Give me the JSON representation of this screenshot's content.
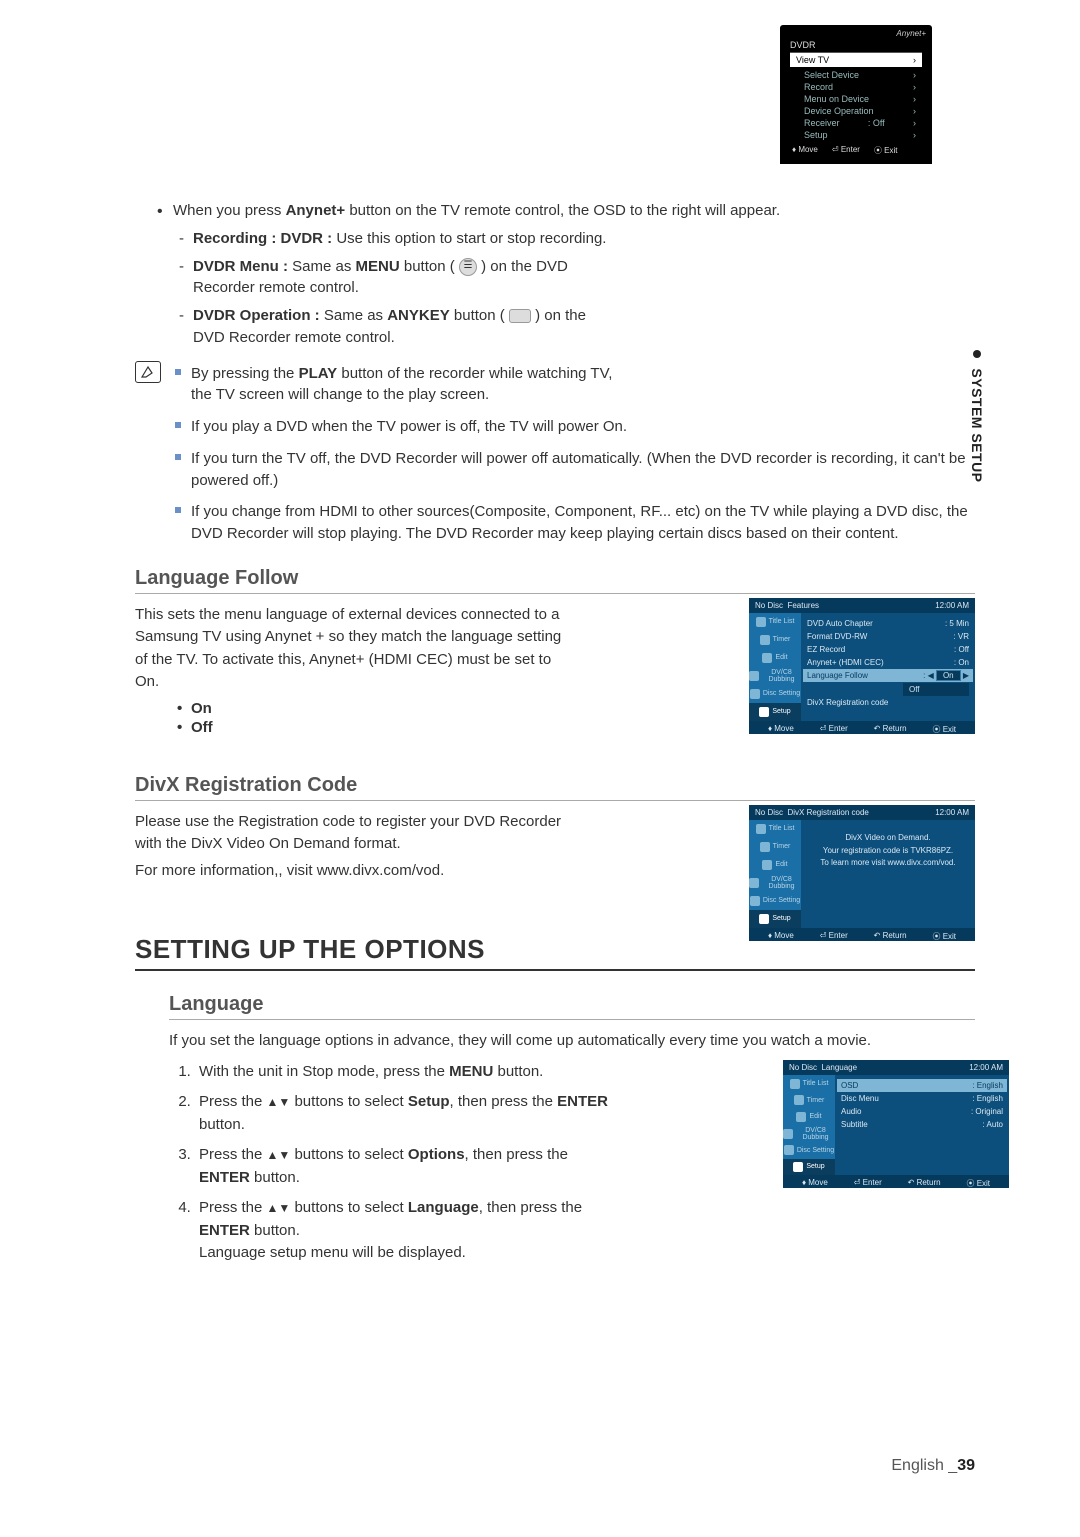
{
  "side_tab": "SYSTEM SETUP",
  "intro": {
    "line1_pre": "When you press ",
    "line1_bold": "Anynet+",
    "line1_post": " button on the TV remote control, the OSD to the right will appear.",
    "d1_label": "Recording : DVDR :",
    "d1_text": " Use this option to start or stop recording.",
    "d2_label": "DVDR Menu :",
    "d2_mid": " Same as ",
    "d2_bold": "MENU",
    "d2_text": " button (        ) on the DVD Recorder remote control.",
    "d3_label": "DVDR Operation :",
    "d3_mid": " Same as ",
    "d3_bold": "ANYKEY",
    "d3_text": " button (        ) on the DVD Recorder remote control."
  },
  "notes": {
    "n1a": "By pressing the ",
    "n1b": "PLAY",
    "n1c": " button of the recorder while watching TV, the TV screen will change to the play screen.",
    "n2": "If you play a DVD when the TV power is off, the TV will power On.",
    "n3": "If you turn the TV off, the DVD Recorder will power off automatically. (When the DVD recorder is recording, it can't be powered off.)",
    "n4": "If you change from HDMI to other sources(Composite, Component, RF... etc) on the TV while playing a DVD disc, the DVD Recorder will stop playing. The DVD Recorder may keep playing certain discs based on their content."
  },
  "lang_follow": {
    "heading": "Language Follow",
    "body": "This sets the menu language of external devices connected to a Samsung TV using Anynet + so they match the language setting of the TV. To activate this, Anynet+ (HDMI CEC) must be set to On.",
    "on": "On",
    "off": "Off"
  },
  "divx": {
    "heading": "DivX Registration Code",
    "line1": "Please use the Registration code to register your DVD Recorder with the DivX Video On Demand format.",
    "line2": "For more information,, visit www.divx.com/vod."
  },
  "main_heading": "SETTING UP THE OPTIONS",
  "language": {
    "heading": "Language",
    "intro": "If you set the language options in advance, they will come up automatically every time you watch a movie.",
    "s1a": "With the unit in Stop mode, press the ",
    "s1b": "MENU",
    "s1c": " button.",
    "s2a": "Press the ",
    "s2b": " buttons to select ",
    "s2c": "Setup",
    "s2d": ", then press the ",
    "s2e": "ENTER",
    "s2f": " button.",
    "s3c": "Options",
    "s4c": "Language",
    "s4g": "Language setup menu will be displayed."
  },
  "osd": {
    "logo": "Anynet+",
    "header": "DVDR",
    "view": "View TV",
    "rows": [
      [
        "Select Device",
        ""
      ],
      [
        "Record",
        ""
      ],
      [
        "Menu on Device",
        ""
      ],
      [
        "Device Operation",
        ""
      ],
      [
        "Receiver",
        ": Off"
      ],
      [
        "Setup",
        ""
      ]
    ],
    "f1": "Move",
    "f2": "Enter",
    "f3": "Exit"
  },
  "shot_common": {
    "nodisc": "No Disc",
    "time": "12:00 AM",
    "side": [
      "Title List",
      "Timer",
      "Edit",
      "DV/C8 Dubbing",
      "Disc Setting",
      "Setup"
    ],
    "move": "Move",
    "enter": "Enter",
    "return": "Return",
    "exit": "Exit"
  },
  "shot1": {
    "title": "Features",
    "rows": [
      [
        "DVD Auto Chapter",
        ": 5 Min"
      ],
      [
        "Format DVD-RW",
        ": VR"
      ],
      [
        "EZ Record",
        ": Off"
      ],
      [
        "Anynet+ (HDMI CEC)",
        ": On"
      ]
    ],
    "hl_label": "Language Follow",
    "hl_val": "On",
    "opt": "Off",
    "below": "DivX Registration code"
  },
  "shot2": {
    "title": "DivX Registration code",
    "l1": "DivX Video on Demand.",
    "l2": "Your registration code is TVKR86PZ.",
    "l3": "To learn more visit www.divx.com/vod."
  },
  "shot3": {
    "title": "Language",
    "rows": [
      [
        "OSD",
        ": English"
      ],
      [
        "Disc Menu",
        ": English"
      ],
      [
        "Audio",
        ": Original"
      ],
      [
        "Subtitle",
        ": Auto"
      ]
    ]
  },
  "footer": {
    "lang": "English",
    "sep": " _",
    "page": "39"
  }
}
